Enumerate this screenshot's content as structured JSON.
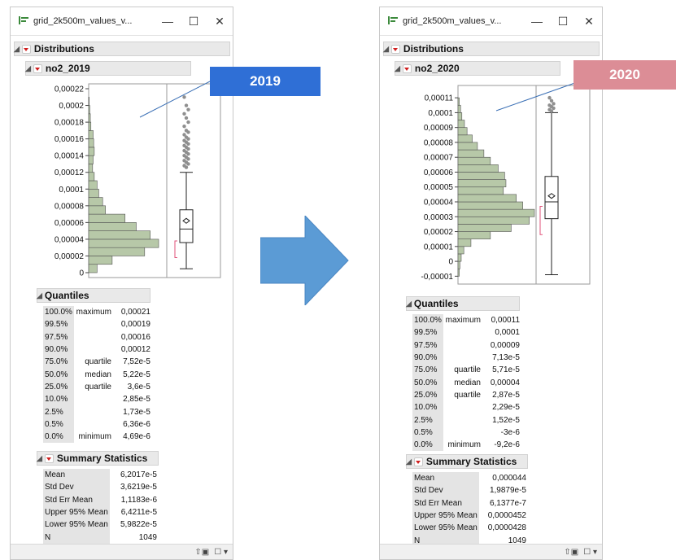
{
  "colors": {
    "badge_2019": "#2f6fd6",
    "badge_2020": "#dc8d96",
    "arrow": "#5b9bd5",
    "bar_fill": "#b7c8a8",
    "bar_stroke": "#555555",
    "outlier": "#8f8f8f",
    "bracket": "#e0527a"
  },
  "left": {
    "title": "grid_2k500m_values_v...",
    "controls": {
      "minimize": "—",
      "maximize": "☐",
      "close": "✕"
    },
    "distributions_label": "Distributions",
    "variable_label": "no2_2019",
    "quantiles_label": "Quantiles",
    "summary_label": "Summary Statistics",
    "quantiles": [
      [
        "100.0%",
        "maximum",
        "0,00021"
      ],
      [
        "99.5%",
        "",
        "0,00019"
      ],
      [
        "97.5%",
        "",
        "0,00016"
      ],
      [
        "90.0%",
        "",
        "0,00012"
      ],
      [
        "75.0%",
        "quartile",
        "7,52e-5"
      ],
      [
        "50.0%",
        "median",
        "5,22e-5"
      ],
      [
        "25.0%",
        "quartile",
        "3,6e-5"
      ],
      [
        "10.0%",
        "",
        "2,85e-5"
      ],
      [
        "2.5%",
        "",
        "1,73e-5"
      ],
      [
        "0.5%",
        "",
        "6,36e-6"
      ],
      [
        "0.0%",
        "minimum",
        "4,69e-6"
      ]
    ],
    "summary": [
      [
        "Mean",
        "6,2017e-5"
      ],
      [
        "Std Dev",
        "3,6219e-5"
      ],
      [
        "Std Err Mean",
        "1,1183e-6"
      ],
      [
        "Upper 95% Mean",
        "6,4211e-5"
      ],
      [
        "Lower 95% Mean",
        "5,9822e-5"
      ],
      [
        "N",
        "1049"
      ]
    ]
  },
  "right": {
    "title": "grid_2k500m_values_v...",
    "controls": {
      "minimize": "—",
      "maximize": "☐",
      "close": "✕"
    },
    "distributions_label": "Distributions",
    "variable_label": "no2_2020",
    "quantiles_label": "Quantiles",
    "summary_label": "Summary Statistics",
    "quantiles": [
      [
        "100.0%",
        "maximum",
        "0,00011"
      ],
      [
        "99.5%",
        "",
        "0,0001"
      ],
      [
        "97.5%",
        "",
        "0,00009"
      ],
      [
        "90.0%",
        "",
        "7,13e-5"
      ],
      [
        "75.0%",
        "quartile",
        "5,71e-5"
      ],
      [
        "50.0%",
        "median",
        "0,00004"
      ],
      [
        "25.0%",
        "quartile",
        "2,87e-5"
      ],
      [
        "10.0%",
        "",
        "2,29e-5"
      ],
      [
        "2.5%",
        "",
        "1,52e-5"
      ],
      [
        "0.5%",
        "",
        "-3e-6"
      ],
      [
        "0.0%",
        "minimum",
        "-9,2e-6"
      ]
    ],
    "summary": [
      [
        "Mean",
        "0,000044"
      ],
      [
        "Std Dev",
        "1,9879e-5"
      ],
      [
        "Std Err Mean",
        "6,1377e-7"
      ],
      [
        "Upper 95% Mean",
        "0,0000452"
      ],
      [
        "Lower 95% Mean",
        "0,0000428"
      ],
      [
        "N",
        "1049"
      ]
    ]
  },
  "badges": {
    "left": "2019",
    "right": "2020"
  },
  "chart_data": [
    {
      "type": "bar",
      "orientation": "horizontal",
      "ylim": [
        0,
        0.00022
      ],
      "ticks": [
        "0,00022",
        "0,0002",
        "0,00018",
        "0,00016",
        "0,00014",
        "0,00012",
        "0,0001",
        "0,00008",
        "0,00006",
        "0,00004",
        "0,00002",
        "0"
      ],
      "tick_values": [
        0.00022,
        0.0002,
        0.00018,
        0.00016,
        0.00014,
        0.00012,
        0.0001,
        8e-05,
        6e-05,
        4e-05,
        2e-05,
        0
      ],
      "bin_width": 1e-05,
      "bins": [
        [
          0,
          1e-05
        ],
        [
          1e-05,
          2e-05
        ],
        [
          2e-05,
          3e-05
        ],
        [
          3e-05,
          4e-05
        ],
        [
          4e-05,
          5e-05
        ],
        [
          5e-05,
          6e-05
        ],
        [
          6e-05,
          7e-05
        ],
        [
          7e-05,
          8e-05
        ],
        [
          8e-05,
          9e-05
        ],
        [
          9e-05,
          0.0001
        ],
        [
          0.0001,
          0.00011
        ],
        [
          0.00011,
          0.00012
        ],
        [
          0.00012,
          0.00013
        ],
        [
          0.00013,
          0.00014
        ],
        [
          0.00014,
          0.00015
        ],
        [
          0.00015,
          0.00016
        ],
        [
          0.00016,
          0.00017
        ],
        [
          0.00017,
          0.00018
        ],
        [
          0.00018,
          0.00019
        ],
        [
          0.00019,
          0.0002
        ],
        [
          0.0002,
          0.00021
        ]
      ],
      "counts": [
        15,
        42,
        100,
        125,
        110,
        85,
        65,
        30,
        25,
        18,
        15,
        10,
        7,
        8,
        10,
        9,
        8,
        4,
        3,
        2,
        1
      ],
      "boxplot": {
        "min": 4.7e-06,
        "q1": 3.6e-05,
        "median": 5.22e-05,
        "q3": 7.52e-05,
        "upper_whisker": 0.00012,
        "mean": 6.2e-05,
        "mean_ci": [
          5.98e-05,
          6.42e-05
        ],
        "shortest_half": [
          1.8e-05,
          3.8e-05
        ]
      },
      "outliers": [
        0.00021,
        0.0002,
        0.000195,
        0.00019,
        0.000185,
        0.00018,
        0.000175,
        0.00017,
        0.000168,
        0.000165,
        0.000162,
        0.00016,
        0.000158,
        0.000156,
        0.000154,
        0.000152,
        0.00015,
        0.000148,
        0.000146,
        0.000144,
        0.000142,
        0.00014,
        0.000138,
        0.000136,
        0.000134,
        0.000132,
        0.00013,
        0.000128,
        0.000126
      ]
    },
    {
      "type": "bar",
      "orientation": "horizontal",
      "ylim": [
        -1.2e-05,
        0.000115
      ],
      "ticks": [
        "0,00011",
        "0,0001",
        "0,00009",
        "0,00008",
        "0,00007",
        "0,00006",
        "0,00005",
        "0,00004",
        "0,00003",
        "0,00002",
        "0,00001",
        "0",
        "-0,00001"
      ],
      "tick_values": [
        0.00011,
        0.0001,
        9e-05,
        8e-05,
        7e-05,
        6e-05,
        5e-05,
        4e-05,
        3e-05,
        2e-05,
        1e-05,
        0,
        -1e-05
      ],
      "bin_width": 5e-06,
      "bins": [
        [
          -1e-05,
          -5e-06
        ],
        [
          -5e-06,
          0
        ],
        [
          0,
          5e-06
        ],
        [
          5e-06,
          1e-05
        ],
        [
          1e-05,
          1.5e-05
        ],
        [
          1.5e-05,
          2e-05
        ],
        [
          2e-05,
          2.5e-05
        ],
        [
          2.5e-05,
          3e-05
        ],
        [
          3e-05,
          3.5e-05
        ],
        [
          3.5e-05,
          4e-05
        ],
        [
          4e-05,
          4.5e-05
        ],
        [
          4.5e-05,
          5e-05
        ],
        [
          5e-05,
          5.5e-05
        ],
        [
          5.5e-05,
          6e-05
        ],
        [
          6e-05,
          6.5e-05
        ],
        [
          6.5e-05,
          7e-05
        ],
        [
          7e-05,
          7.5e-05
        ],
        [
          7.5e-05,
          8e-05
        ],
        [
          8e-05,
          8.5e-05
        ],
        [
          8.5e-05,
          9e-05
        ],
        [
          9e-05,
          9.5e-05
        ],
        [
          9.5e-05,
          0.0001
        ],
        [
          0.0001,
          0.000105
        ],
        [
          0.000105,
          0.00011
        ]
      ],
      "counts": [
        2,
        3,
        5,
        9,
        20,
        50,
        82,
        110,
        118,
        100,
        90,
        70,
        74,
        72,
        62,
        50,
        40,
        30,
        22,
        14,
        10,
        6,
        4,
        2
      ],
      "boxplot": {
        "min": -9e-06,
        "q1": 2.87e-05,
        "median": 4e-05,
        "q3": 5.71e-05,
        "upper_whisker": 0.0001,
        "mean": 4.4e-05,
        "mean_ci": [
          4.28e-05,
          4.52e-05
        ],
        "shortest_half": [
          1.8e-05,
          3.7e-05
        ]
      },
      "outliers": [
        0.00011,
        0.000108,
        0.000106,
        0.000105,
        0.000104,
        0.000103,
        0.000102,
        0.000101
      ]
    }
  ]
}
